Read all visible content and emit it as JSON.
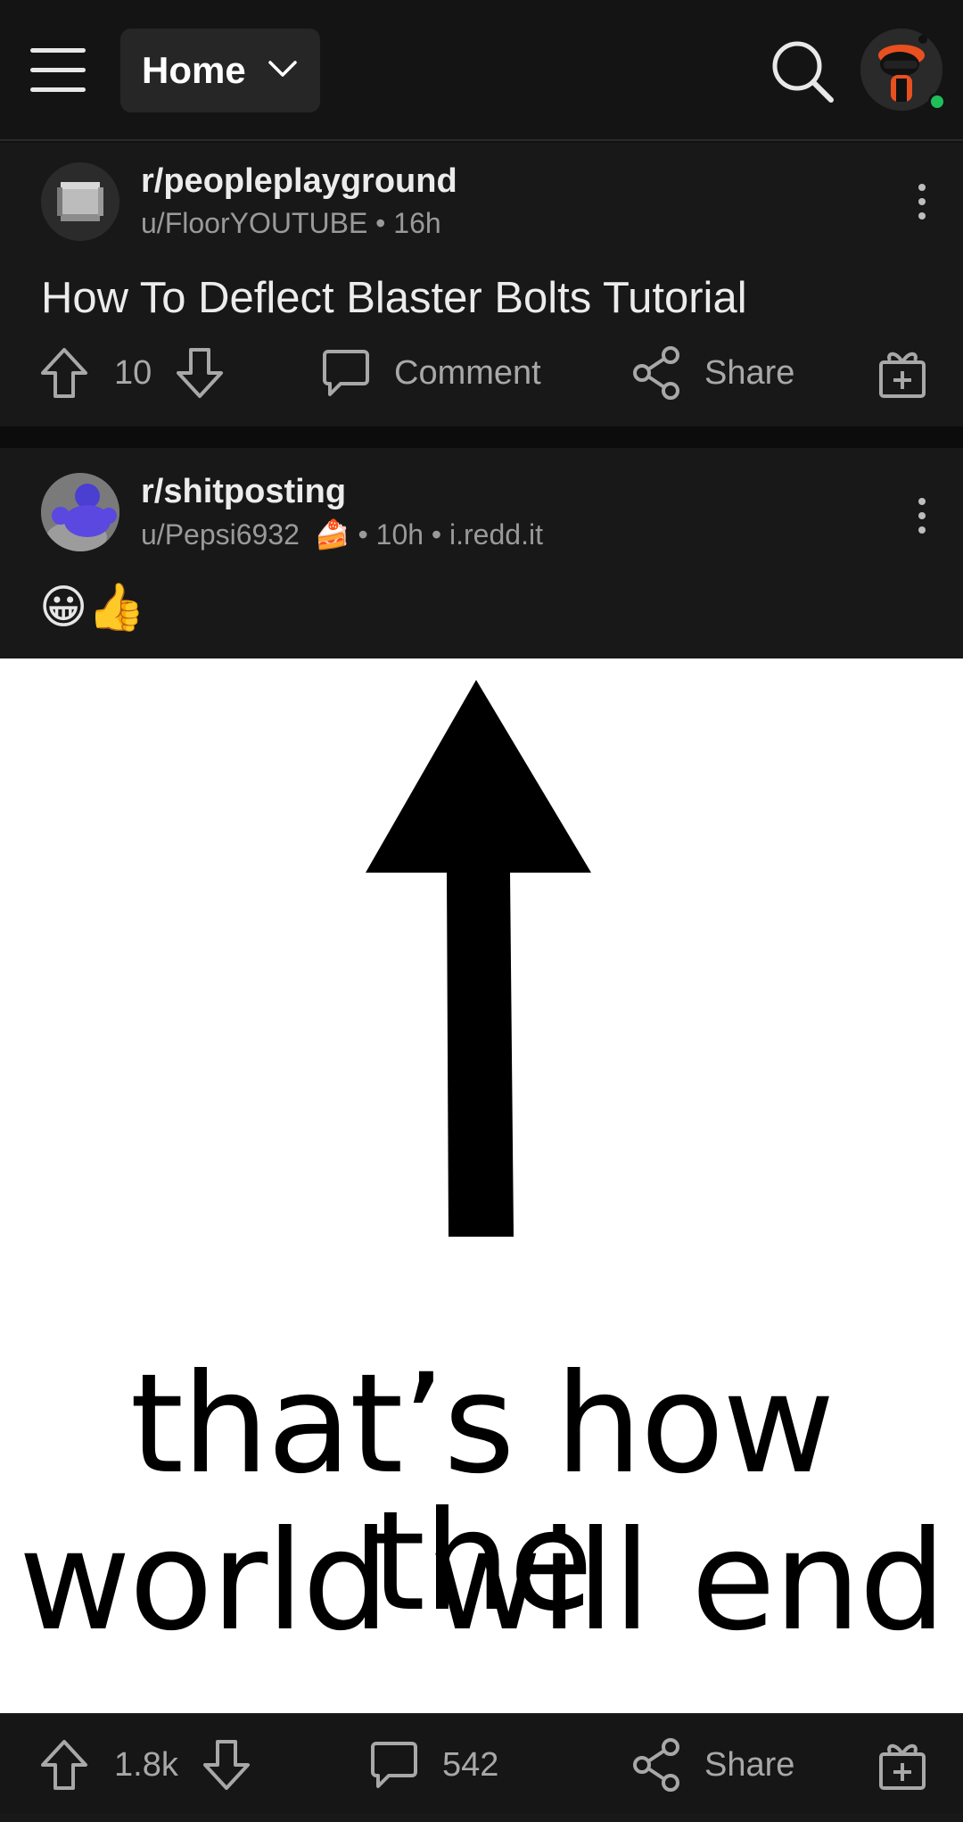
{
  "header": {
    "feed_label": "Home",
    "icons": [
      "menu-icon",
      "chevron-down-icon",
      "search-icon",
      "user-avatar"
    ],
    "online_status_color": "#1fbf5a"
  },
  "posts": [
    {
      "subreddit": "r/peopleplayground",
      "author": "u/FloorYOUTUBE",
      "age": "16h",
      "title": "How To Deflect Blaster Bolts Tutorial",
      "votes": "10",
      "comment_label": "Comment",
      "share_label": "Share"
    },
    {
      "subreddit": "r/shitposting",
      "author": "u/Pepsi6932",
      "author_badge": "🍰",
      "age": "10h",
      "domain": "i.redd.it",
      "title": "😀👍",
      "image_caption_line1": "that’s how the",
      "image_caption_line2": "world will end",
      "votes": "1.8k",
      "comments": "542",
      "share_label": "Share"
    }
  ],
  "colors": {
    "background": "#121212",
    "card": "#181818",
    "text_primary": "#ececec",
    "text_secondary": "#9a9a9a"
  }
}
